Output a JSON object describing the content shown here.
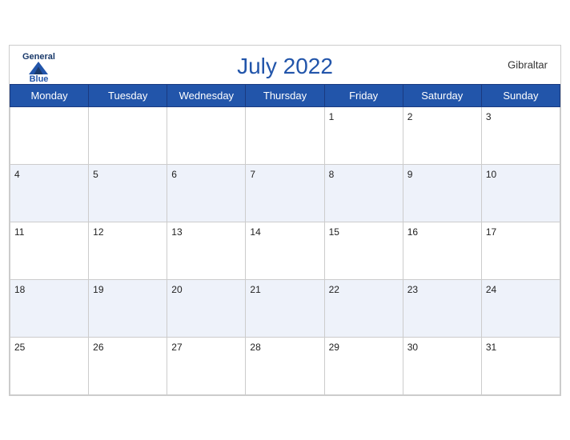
{
  "header": {
    "title": "July 2022",
    "region": "Gibraltar",
    "logo_general": "General",
    "logo_blue": "Blue"
  },
  "weekdays": [
    "Monday",
    "Tuesday",
    "Wednesday",
    "Thursday",
    "Friday",
    "Saturday",
    "Sunday"
  ],
  "weeks": [
    [
      null,
      null,
      null,
      null,
      1,
      2,
      3
    ],
    [
      4,
      5,
      6,
      7,
      8,
      9,
      10
    ],
    [
      11,
      12,
      13,
      14,
      15,
      16,
      17
    ],
    [
      18,
      19,
      20,
      21,
      22,
      23,
      24
    ],
    [
      25,
      26,
      27,
      28,
      29,
      30,
      31
    ]
  ]
}
